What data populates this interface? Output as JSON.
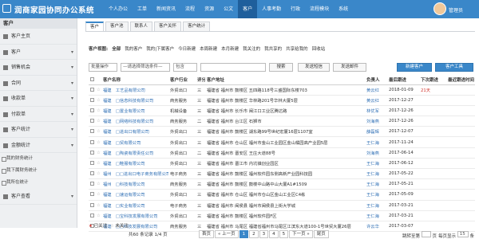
{
  "app": {
    "title": "润商家园协同办公系统"
  },
  "nav": [
    "个人办公",
    "工单",
    "新闻资讯",
    "流程",
    "资源",
    "公文",
    "客户",
    "人事考勤",
    "行政",
    "流程模块",
    "系统"
  ],
  "nav_active": "客户",
  "user": {
    "name": "管理员"
  },
  "sidebar": {
    "header": "客户",
    "items": [
      {
        "label": "客户主页"
      },
      {
        "label": "客户"
      },
      {
        "label": "销售机会"
      },
      {
        "label": "合同"
      },
      {
        "label": "收款单"
      },
      {
        "label": "付款单"
      },
      {
        "label": "客户统计"
      },
      {
        "label": "金额统计"
      }
    ],
    "subs": [
      "我的财务统计",
      "我下属财务统计",
      "我所在统计"
    ],
    "last": "客户查看"
  },
  "tabs": [
    "客户",
    "客户池",
    "联系人",
    "客户关怀",
    "客户统计"
  ],
  "views": {
    "label": "客户视图:",
    "items": [
      "全部",
      "我的客户",
      "我的|下属客户",
      "今日新建",
      "本周新建",
      "本月新建",
      "我关注的",
      "我共享的",
      "共享给我的",
      "回收站"
    ]
  },
  "filters": {
    "batch": "批量操作",
    "field": "—请选择筛选条件—",
    "op": "包含",
    "search": "搜索",
    "sms": "发送短信",
    "mail": "发送邮件",
    "new": "新建客户",
    "tools": "客户工具"
  },
  "table": {
    "headers": [
      "",
      "",
      "客户名称",
      "客户行业",
      "评分",
      "地区",
      "客户地址",
      "负责人",
      "最后跟进",
      "下次跟进",
      "最近跟进时间"
    ],
    "rows": [
      [
        "福建",
        "工艺品有限公司",
        "外贸出口",
        "三",
        "福建省 福州市 鼓楼区 五四路118号三盛国际东楼703",
        "黄云红",
        "2018-01-09",
        "21天"
      ],
      [
        "福建",
        "□信息科技有限公司",
        "商务服务",
        "三",
        "福建省 福州市 鼓楼区 华林路201号华林大厦5层",
        "黄云红",
        "2017-12-27",
        ""
      ],
      [
        "福建",
        "□置业有限公司",
        "机械设备",
        "三",
        "福建省 福州市 长乐市 闽江口工业区腾达路",
        "林优军",
        "2017-12-26",
        ""
      ],
      [
        "福建",
        "□网络科技有限公司",
        "商务服务",
        "二",
        "福建省 福州市 台江区 石狮市",
        "刘海燕",
        "2017-12-26",
        ""
      ],
      [
        "福建",
        "□进出口有限公司",
        "外贸出口",
        "三",
        "福建省 福州市 鼓楼区 湖东路99号世纪宏厦16层1107室",
        "薛磊辉",
        "2017-12-07",
        ""
      ],
      [
        "福建",
        "□贸有限公司",
        "外贸出口",
        "三",
        "福建省 福州市 仓山区 福州市金山工业园区金山橘园高产业园5层",
        "王仁海",
        "2017-11-24",
        ""
      ],
      [
        "福建",
        "□陶瓷有限责任公司",
        "外贸出口",
        "二",
        "福建省 福州市 晋安区 王庄大道88号",
        "刘海燕",
        "2017-06-14",
        ""
      ],
      [
        "福建",
        "□鞋服有限公司",
        "外贸出口",
        "三",
        "福建省 福州市 晋江市 内坑镇创业园区",
        "王仁海",
        "2017-06-12",
        ""
      ],
      [
        "福州",
        "□□进出口电子商务有限公司",
        "电子商务",
        "三",
        "福建省 福州市 鼓楼区 福州软件园东侧高新产业园科技园",
        "王仁海",
        "2017-05-22",
        ""
      ],
      [
        "福州",
        "□科技有限公司",
        "商务服务",
        "三",
        "福建省 福州市 鼓楼区 鼓楼中山路中山大厦A1#1509",
        "王仁海",
        "2017-05-21",
        ""
      ],
      [
        "福建",
        "□速运有限公司",
        "外贸出口",
        "三",
        "福建省 福州市 仓山区 福州市仓山区金山工业区C4栋",
        "王仁海",
        "2017-05-09",
        ""
      ],
      [
        "福建",
        "□实业有限公司",
        "电子商务",
        "三",
        "福建省 福州市 闽侯县 福州市闽侯县上街大学城",
        "王仁海",
        "2017-03-21",
        ""
      ],
      [
        "福建",
        "□宝科技发展有限公司",
        "外贸出口",
        "三",
        "福建省 福州市 鼓楼区 福州软件园F区",
        "王仁海",
        "2017-03-21",
        ""
      ],
      [
        "福建",
        "□□科技发展有限公司",
        "商务服务",
        "三",
        "福建省 福州市 马尾区 福建省福州市马尾区江滨东大道100-1号世贸大厦26层",
        "许云华",
        "2017-03-07",
        ""
      ]
    ]
  },
  "legend": {
    "a": "已关注",
    "b": "未关注"
  },
  "footer": {
    "total": "共60 条记录 1/4 页",
    "pages": [
      "首页",
      "« 上一页",
      "1",
      "2",
      "3",
      "4",
      "5",
      "下一页 »",
      "尾页"
    ],
    "current": "1",
    "jump": "跳转至第",
    "jump_unit": "页",
    "perpage": "每页显示",
    "perpage_val": "15",
    "perpage_unit": "条"
  }
}
